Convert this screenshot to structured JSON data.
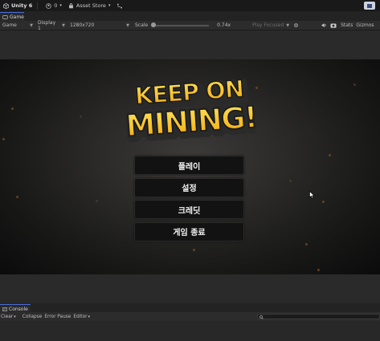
{
  "topbar": {
    "app_name": "Unity 6",
    "account_count": "0",
    "asset_store": "Asset Store"
  },
  "game_tab": {
    "label": "Game"
  },
  "toolbar": {
    "view": "Game",
    "display": "Display 1",
    "resolution": "1280x720",
    "scale_label": "Scale",
    "scale_value": "0.74x",
    "play_mode": "Play Focused",
    "stats": "Stats",
    "gizmos": "Gizmos"
  },
  "game": {
    "logo_line1": "KEEP ON",
    "logo_line2": "MINING!",
    "menu": [
      {
        "label": "플레이"
      },
      {
        "label": "설정"
      },
      {
        "label": "크레딧"
      },
      {
        "label": "게임 종료"
      }
    ]
  },
  "console": {
    "tab_label": "Console",
    "clear": "Clear",
    "collapse": "Collapse",
    "error_pause": "Error Pause",
    "editor": "Editor"
  }
}
